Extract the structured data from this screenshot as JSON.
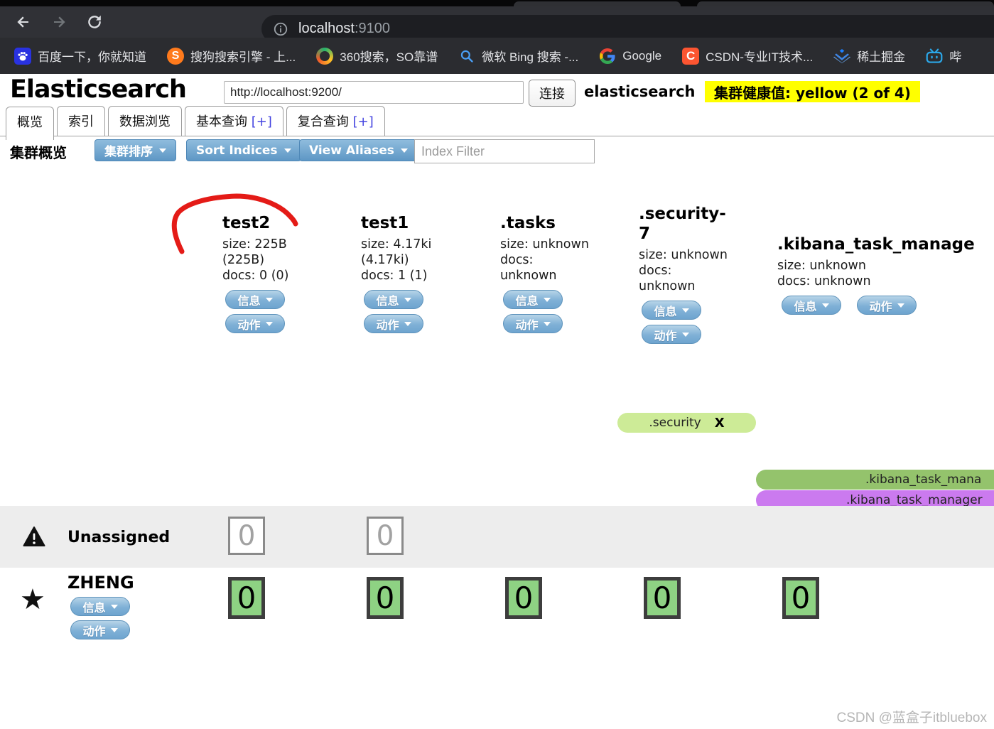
{
  "browser": {
    "url": {
      "host": "localhost",
      "port": ":9100"
    },
    "bookmarks": [
      {
        "icon": "baidu-paw-icon",
        "label": "百度一下，你就知道"
      },
      {
        "icon": "sogou-icon",
        "label": "搜狗搜索引擎 - 上...",
        "glyph": "S"
      },
      {
        "icon": "360-icon",
        "label": "360搜索，SO靠谱"
      },
      {
        "icon": "bing-search-icon",
        "label": "微软 Bing 搜索 -..."
      },
      {
        "icon": "google-icon",
        "label": "Google"
      },
      {
        "icon": "csdn-icon",
        "label": "CSDN-专业IT技术...",
        "glyph": "C"
      },
      {
        "icon": "juejin-icon",
        "label": "稀土掘金"
      },
      {
        "icon": "bilibili-icon",
        "label": "哔"
      }
    ]
  },
  "app": {
    "title": "Elasticsearch",
    "endpoint_value": "http://localhost:9200/",
    "connect_label": "连接",
    "cluster_name": "elasticsearch",
    "health_text": "集群健康值: yellow (2 of 4)",
    "health_color": "#ffff00",
    "tabs": [
      {
        "label": "概览"
      },
      {
        "label": "索引"
      },
      {
        "label": "数据浏览"
      },
      {
        "label": "基本查询 ",
        "plus": "[+]"
      },
      {
        "label": "复合查询 ",
        "plus": "[+]"
      }
    ]
  },
  "overview": {
    "heading": "集群概览",
    "cluster_sort_label": "集群排序",
    "sort_indices_label": "Sort Indices",
    "view_aliases_label": "View Aliases",
    "index_filter_placeholder": "Index Filter",
    "info_label": "信息",
    "action_label": "动作",
    "indices": [
      {
        "name": "test2",
        "line1": "size: 225B",
        "line2": "(225B)",
        "line3": "docs: 0 (0)"
      },
      {
        "name": "test1",
        "line1": "size: 4.17ki",
        "line2": "(4.17ki)",
        "line3": "docs: 1 (1)"
      },
      {
        "name": ".tasks",
        "line1": "size: unknown",
        "line2": "docs:",
        "line3": "unknown"
      },
      {
        "name": ".security-7",
        "line1": "size: unknown",
        "line2": "docs:",
        "line3": "unknown"
      },
      {
        "name": ".kibana_task_manage",
        "line1": "size: unknown",
        "line2": "docs: unknown"
      }
    ],
    "aliases": {
      "security": {
        "label": ".security",
        "close": "X",
        "color": "#cdeb97"
      },
      "kibana_green": {
        "label": ".kibana_task_mana",
        "color": "#94c36c"
      },
      "kibana_purple": {
        "label": ".kibana_task_manager",
        "color": "#cb7aef"
      }
    },
    "rows": [
      {
        "label": "Unassigned",
        "cells": [
          "0",
          "0"
        ]
      },
      {
        "label": "ZHENG",
        "cells": [
          "0",
          "0",
          "0",
          "0",
          "0"
        ]
      }
    ]
  },
  "watermark": "CSDN @蓝盒子itbluebox"
}
